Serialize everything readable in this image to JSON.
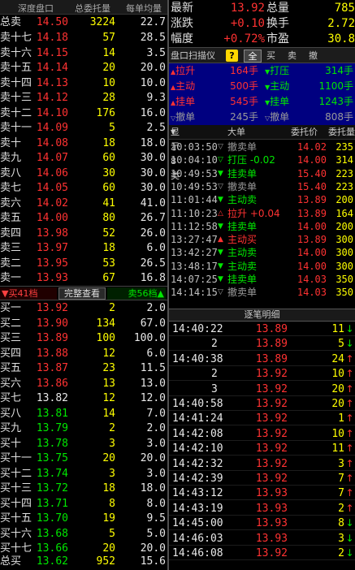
{
  "colors": {
    "up": "#ff3232",
    "down": "#00e600",
    "volume": "#ffff00",
    "background": "#000000"
  },
  "orderbook": {
    "header": {
      "col1": "深度盘口",
      "col2": "总委托量",
      "col3": "每单均量"
    },
    "total_sell": {
      "label": "总卖",
      "price": "14.50",
      "vol": "3224",
      "avg": "22.7",
      "color": "red"
    },
    "sells": [
      {
        "label": "卖十七",
        "price": "14.18",
        "vol": "57",
        "avg": "28.5",
        "color": "red"
      },
      {
        "label": "卖十六",
        "price": "14.15",
        "vol": "14",
        "avg": "3.5",
        "color": "red"
      },
      {
        "label": "卖十五",
        "price": "14.14",
        "vol": "20",
        "avg": "20.0",
        "color": "red"
      },
      {
        "label": "卖十四",
        "price": "14.13",
        "vol": "10",
        "avg": "10.0",
        "color": "red"
      },
      {
        "label": "卖十三",
        "price": "14.12",
        "vol": "28",
        "avg": "9.3",
        "color": "red"
      },
      {
        "label": "卖十二",
        "price": "14.10",
        "vol": "176",
        "avg": "16.0",
        "color": "red"
      },
      {
        "label": "卖十一",
        "price": "14.09",
        "vol": "5",
        "avg": "2.5",
        "color": "red"
      },
      {
        "label": "卖十",
        "price": "14.08",
        "vol": "18",
        "avg": "18.0",
        "color": "red"
      },
      {
        "label": "卖九",
        "price": "14.07",
        "vol": "60",
        "avg": "30.0",
        "color": "red"
      },
      {
        "label": "卖八",
        "price": "14.06",
        "vol": "30",
        "avg": "30.0",
        "color": "red"
      },
      {
        "label": "卖七",
        "price": "14.05",
        "vol": "60",
        "avg": "30.0",
        "color": "red"
      },
      {
        "label": "卖六",
        "price": "14.02",
        "vol": "41",
        "avg": "41.0",
        "color": "red"
      },
      {
        "label": "卖五",
        "price": "14.00",
        "vol": "80",
        "avg": "26.7",
        "color": "red"
      },
      {
        "label": "卖四",
        "price": "13.98",
        "vol": "52",
        "avg": "26.0",
        "color": "red"
      },
      {
        "label": "卖三",
        "price": "13.97",
        "vol": "18",
        "avg": "6.0",
        "color": "red"
      },
      {
        "label": "卖二",
        "price": "13.95",
        "vol": "53",
        "avg": "26.5",
        "color": "red"
      },
      {
        "label": "卖一",
        "price": "13.93",
        "vol": "67",
        "avg": "16.8",
        "color": "red"
      }
    ],
    "mid_bar": {
      "sell_btn": "▼买41档",
      "full_btn": "完整查看",
      "buy_btn": "卖56档▲"
    },
    "buys": [
      {
        "label": "买一",
        "price": "13.92",
        "vol": "2",
        "avg": "2.0",
        "color": "red"
      },
      {
        "label": "买二",
        "price": "13.90",
        "vol": "134",
        "avg": "67.0",
        "color": "red"
      },
      {
        "label": "买三",
        "price": "13.89",
        "vol": "100",
        "avg": "100.0",
        "color": "red"
      },
      {
        "label": "买四",
        "price": "13.88",
        "vol": "12",
        "avg": "6.0",
        "color": "red"
      },
      {
        "label": "买五",
        "price": "13.87",
        "vol": "23",
        "avg": "11.5",
        "color": "red"
      },
      {
        "label": "买六",
        "price": "13.86",
        "vol": "13",
        "avg": "13.0",
        "color": "red"
      },
      {
        "label": "买七",
        "price": "13.82",
        "vol": "12",
        "avg": "12.0",
        "color": "white"
      },
      {
        "label": "买八",
        "price": "13.81",
        "vol": "14",
        "avg": "7.0",
        "color": "green"
      },
      {
        "label": "买九",
        "price": "13.79",
        "vol": "2",
        "avg": "2.0",
        "color": "green"
      },
      {
        "label": "买十",
        "price": "13.78",
        "vol": "3",
        "avg": "3.0",
        "color": "green"
      },
      {
        "label": "买十一",
        "price": "13.75",
        "vol": "20",
        "avg": "20.0",
        "color": "green"
      },
      {
        "label": "买十二",
        "price": "13.74",
        "vol": "3",
        "avg": "3.0",
        "color": "green"
      },
      {
        "label": "买十三",
        "price": "13.72",
        "vol": "18",
        "avg": "18.0",
        "color": "green"
      },
      {
        "label": "买十四",
        "price": "13.71",
        "vol": "8",
        "avg": "8.0",
        "color": "green"
      },
      {
        "label": "买十五",
        "price": "13.70",
        "vol": "19",
        "avg": "9.5",
        "color": "green"
      },
      {
        "label": "买十六",
        "price": "13.68",
        "vol": "5",
        "avg": "5.0",
        "color": "green"
      },
      {
        "label": "买十七",
        "price": "13.66",
        "vol": "20",
        "avg": "20.0",
        "color": "green"
      }
    ],
    "total_buy": {
      "label": "总买",
      "price": "13.62",
      "vol": "952",
      "avg": "15.6",
      "color": "green"
    }
  },
  "quote": {
    "rows": [
      {
        "l1": "最新",
        "v1": "13.92",
        "l2": "总量",
        "v2": "785"
      },
      {
        "l1": "涨跌",
        "v1": "+0.10",
        "l2": "换手",
        "v2": "2.72"
      },
      {
        "l1": "幅度",
        "v1": "+0.72%",
        "l2": "市盈",
        "v2": "30.8"
      }
    ]
  },
  "scanner": {
    "tabs": {
      "scanner": "盘口扫描仪",
      "help": "?",
      "all": "全",
      "buy": "买",
      "sell": "卖",
      "cancel": "撤"
    },
    "summary": [
      {
        "s1": "拉升",
        "n1": "164手",
        "s2": "打压",
        "n2": "314手"
      },
      {
        "s1": "主动",
        "n1": "500手",
        "s2": "主动",
        "n2": "1100手"
      },
      {
        "s1": "挂单",
        "n1": "545手",
        "s2": "挂单",
        "n2": "1243手"
      },
      {
        "s1": "撤单",
        "n1": "245手",
        "s2": "撤单",
        "n2": "808手"
      }
    ],
    "list_header": {
      "show": "显示8类",
      "big": "大单",
      "price": "委托价",
      "qty": "委托量"
    },
    "events": [
      {
        "time": "10:03:50",
        "icon": "▽",
        "type": "撤卖单",
        "price": "14.02",
        "qty": "235",
        "color": "gray",
        "pcolor": "red"
      },
      {
        "time": "10:04:10",
        "icon": "▽",
        "type": "打压 -0.02",
        "price": "14.00",
        "qty": "314",
        "color": "green",
        "pcolor": "red"
      },
      {
        "time": "10:49:53",
        "icon": "▼",
        "type": "挂卖单",
        "price": "15.40",
        "qty": "223",
        "color": "green",
        "pcolor": "red"
      },
      {
        "time": "10:49:53",
        "icon": "▽",
        "type": "撤卖单",
        "price": "15.40",
        "qty": "223",
        "color": "gray",
        "pcolor": "red"
      },
      {
        "time": "11:01:44",
        "icon": "▼",
        "type": "主动卖",
        "price": "13.89",
        "qty": "200",
        "color": "green",
        "pcolor": "red"
      },
      {
        "time": "11:10:23",
        "icon": "△",
        "type": "拉升 +0.04",
        "price": "13.89",
        "qty": "164",
        "color": "red",
        "pcolor": "red"
      },
      {
        "time": "11:12:58",
        "icon": "▼",
        "type": "挂卖单",
        "price": "14.00",
        "qty": "200",
        "color": "green",
        "pcolor": "red"
      },
      {
        "time": "13:27:47",
        "icon": "▲",
        "type": "主动买",
        "price": "13.89",
        "qty": "300",
        "color": "red",
        "pcolor": "red"
      },
      {
        "time": "13:42:27",
        "icon": "▼",
        "type": "主动卖",
        "price": "14.00",
        "qty": "300",
        "color": "green",
        "pcolor": "red"
      },
      {
        "time": "13:48:17",
        "icon": "▼",
        "type": "主动卖",
        "price": "14.00",
        "qty": "300",
        "color": "green",
        "pcolor": "red"
      },
      {
        "time": "14:07:25",
        "icon": "▼",
        "type": "挂卖单",
        "price": "14.03",
        "qty": "350",
        "color": "green",
        "pcolor": "red"
      },
      {
        "time": "14:14:15",
        "icon": "▽",
        "type": "撤卖单",
        "price": "14.03",
        "qty": "350",
        "color": "gray",
        "pcolor": "red"
      }
    ]
  },
  "ticks": {
    "header": "逐笔明细",
    "rows": [
      {
        "time": "14:40:22",
        "price": "13.89",
        "qty": "11",
        "dir": "down"
      },
      {
        "time": "2",
        "price": "13.89",
        "qty": "5",
        "dir": "down"
      },
      {
        "time": "14:40:38",
        "price": "13.89",
        "qty": "24",
        "dir": "up"
      },
      {
        "time": "2",
        "price": "13.92",
        "qty": "10",
        "dir": "up"
      },
      {
        "time": "3",
        "price": "13.92",
        "qty": "20",
        "dir": "up"
      },
      {
        "time": "14:40:58",
        "price": "13.92",
        "qty": "20",
        "dir": "up"
      },
      {
        "time": "14:41:24",
        "price": "13.92",
        "qty": "1",
        "dir": "up"
      },
      {
        "time": "14:42:08",
        "price": "13.92",
        "qty": "10",
        "dir": "up"
      },
      {
        "time": "14:42:10",
        "price": "13.92",
        "qty": "11",
        "dir": "up"
      },
      {
        "time": "14:42:32",
        "price": "13.92",
        "qty": "3",
        "dir": "up"
      },
      {
        "time": "14:42:39",
        "price": "13.92",
        "qty": "7",
        "dir": "up"
      },
      {
        "time": "14:43:12",
        "price": "13.93",
        "qty": "7",
        "dir": "up"
      },
      {
        "time": "14:43:19",
        "price": "13.93",
        "qty": "2",
        "dir": "up"
      },
      {
        "time": "14:45:00",
        "price": "13.93",
        "qty": "8",
        "dir": "down"
      },
      {
        "time": "14:46:03",
        "price": "13.93",
        "qty": "3",
        "dir": "down"
      },
      {
        "time": "14:46:08",
        "price": "13.92",
        "qty": "2",
        "dir": "down"
      }
    ]
  }
}
